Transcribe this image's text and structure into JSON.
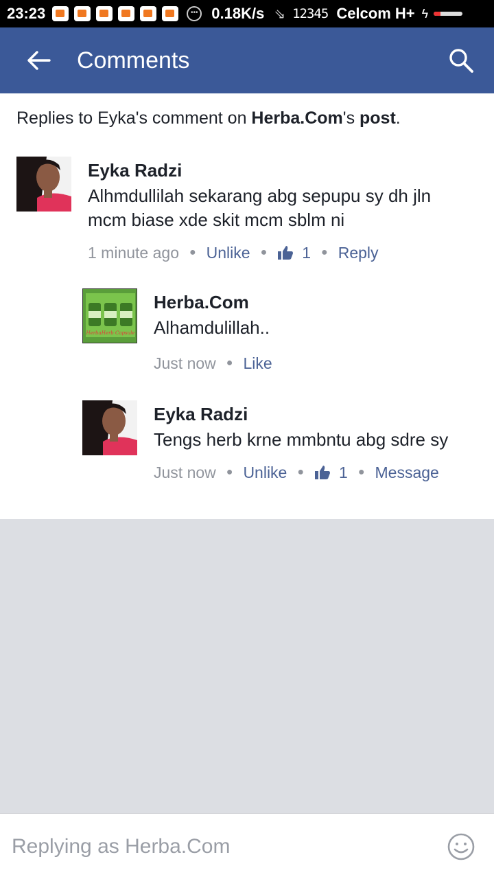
{
  "status_bar": {
    "time": "23:23",
    "net_speed": "0.18K/s",
    "signal_numbers": "12345",
    "carrier": "Celcom H+",
    "notification_icon": "app-notification-icon"
  },
  "appbar": {
    "title": "Comments",
    "accent_color": "#3b5998"
  },
  "context": {
    "prefix": "Replies to Eyka's comment on ",
    "page_name": "Herba.Com",
    "suffix": "'s ",
    "post_word": "post",
    "end": "."
  },
  "comments": [
    {
      "author": "Eyka Radzi",
      "text": "Alhmdullilah sekarang abg sepupu sy dh jln mcm biase xde skit mcm sblm ni",
      "time": "1 minute ago",
      "action1": "Unlike",
      "likes": "1",
      "action2": "Reply"
    },
    {
      "author": "Herba.Com",
      "text": "Alhamdulillah..",
      "time": "Just now",
      "action1": "Like",
      "avatar_caption": "HerbaHerb Capsule"
    },
    {
      "author": "Eyka Radzi",
      "text": "Tengs herb krne mmbntu abg sdre sy",
      "time": "Just now",
      "action1": "Unlike",
      "likes": "1",
      "action2": "Message"
    }
  ],
  "composer": {
    "placeholder": "Replying as Herba.Com"
  }
}
